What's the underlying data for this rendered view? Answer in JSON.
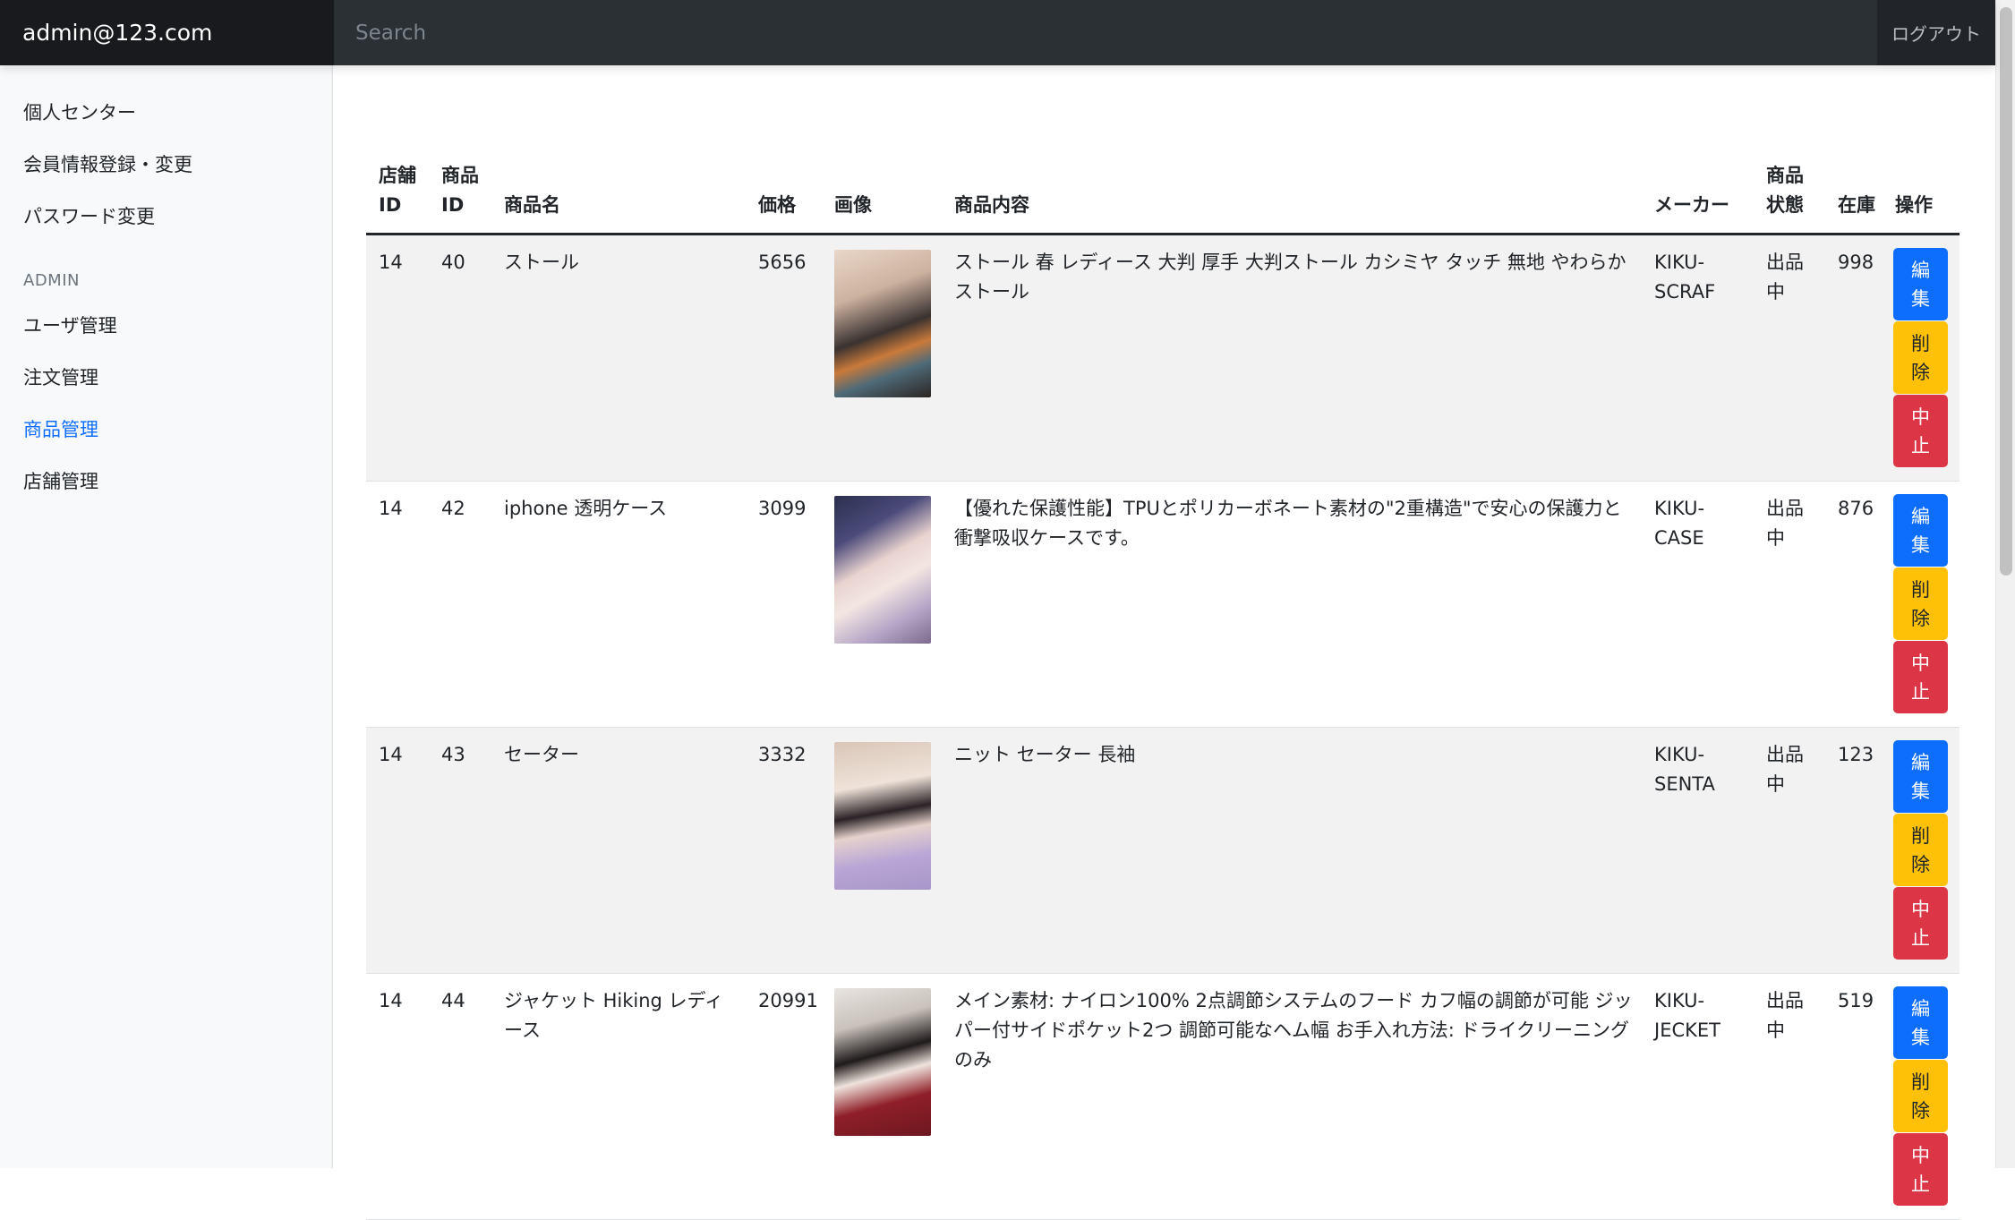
{
  "navbar": {
    "brand": "admin@123.com",
    "search_placeholder": "Search",
    "logout_label": "ログアウト"
  },
  "sidebar": {
    "items": [
      {
        "label": "個人センター"
      },
      {
        "label": "会員情報登録・変更"
      },
      {
        "label": "パスワード変更"
      }
    ],
    "admin_heading": "ADMIN",
    "admin_items": [
      {
        "label": "ユーザ管理"
      },
      {
        "label": "注文管理"
      },
      {
        "label": "商品管理",
        "active": true
      },
      {
        "label": "店舗管理"
      }
    ]
  },
  "table": {
    "headers": {
      "store_id": "店舗ID",
      "product_id": "商品ID",
      "name": "商品名",
      "price": "価格",
      "image": "画像",
      "description": "商品内容",
      "maker": "メーカー",
      "status": "商品状態",
      "stock": "在庫",
      "actions": "操作"
    },
    "action_labels": {
      "edit": "編集",
      "delete": "削除",
      "suspend": "中止"
    },
    "rows": [
      {
        "store_id": "14",
        "product_id": "40",
        "name": "ストール",
        "price": "5656",
        "description": "ストール 春 レディース 大判 厚手 大判ストール カシミヤ タッチ 無地 やわらか ストール",
        "maker": "KIKU-SCRAF",
        "status": "出品中",
        "stock": "998"
      },
      {
        "store_id": "14",
        "product_id": "42",
        "name": "iphone 透明ケース",
        "price": "3099",
        "description": "【優れた保護性能】TPUとポリカーボネート素材の\"2重構造\"で安心の保護力と衝撃吸収ケースです。",
        "maker": "KIKU-CASE",
        "status": "出品中",
        "stock": "876"
      },
      {
        "store_id": "14",
        "product_id": "43",
        "name": "セーター",
        "price": "3332",
        "description": "ニット セーター 長袖",
        "maker": "KIKU-SENTA",
        "status": "出品中",
        "stock": "123"
      },
      {
        "store_id": "14",
        "product_id": "44",
        "name": "ジャケット Hiking レディース",
        "price": "20991",
        "description": "メイン素材: ナイロン100% 2点調節システムのフード カフ幅の調節が可能 ジッパー付サイドポケット2つ 調節可能なヘム幅 お手入れ方法: ドライクリーニングのみ",
        "maker": "KIKU-JECKET",
        "status": "出品中",
        "stock": "519"
      }
    ]
  },
  "colors": {
    "navbar_bg": "#212529",
    "brand_bg": "#181a1d",
    "search_bg": "#2b3035",
    "sidebar_bg": "#f8f9fa",
    "active_link": "#0d6efd",
    "edit_button": "#0d6efd",
    "delete_button": "#ffc107",
    "suspend_button": "#dc3545",
    "stripe": "#f2f2f2"
  }
}
